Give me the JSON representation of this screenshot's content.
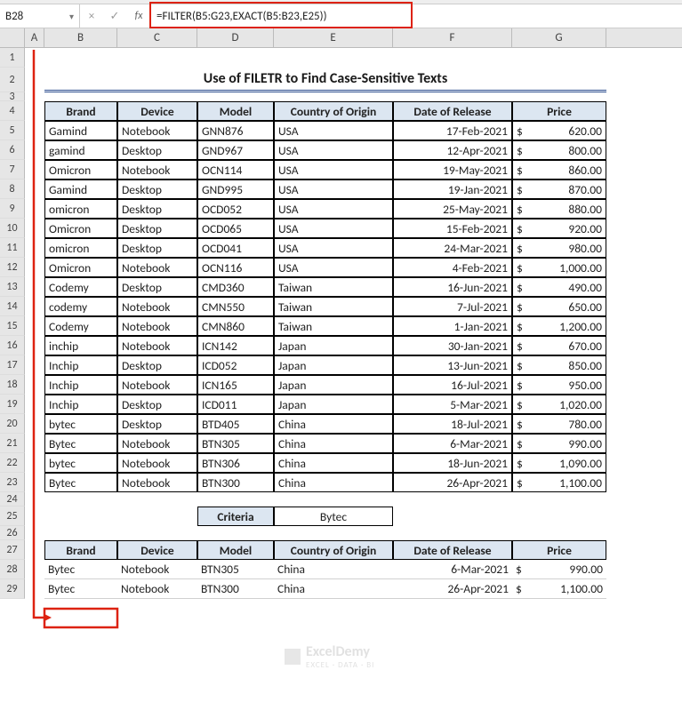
{
  "name_box": "B28",
  "fx_label": "fx",
  "formula": "=FILTER(B5:G23,EXACT(B5:B23,E25))",
  "columns": {
    "A": "A",
    "B": "B",
    "C": "C",
    "D": "D",
    "E": "E",
    "F": "F",
    "G": "G"
  },
  "title": "Use of FILETR to Find Case-Sensitive Texts",
  "headers": [
    "Brand",
    "Device",
    "Model",
    "Country of Origin",
    "Date of Release",
    "Price"
  ],
  "rows": [
    {
      "n": 5,
      "b": "Gamind",
      "c": "Notebook",
      "d": "GNN876",
      "e": "USA",
      "f": "17-Feb-2021",
      "g": "620.00"
    },
    {
      "n": 6,
      "b": "gamind",
      "c": "Desktop",
      "d": "GND967",
      "e": "USA",
      "f": "12-Apr-2021",
      "g": "800.00"
    },
    {
      "n": 7,
      "b": "Omicron",
      "c": "Notebook",
      "d": "OCN114",
      "e": "USA",
      "f": "19-May-2021",
      "g": "860.00"
    },
    {
      "n": 8,
      "b": "Gamind",
      "c": "Desktop",
      "d": "GND995",
      "e": "USA",
      "f": "19-Jan-2021",
      "g": "870.00"
    },
    {
      "n": 9,
      "b": "omicron",
      "c": "Desktop",
      "d": "OCD052",
      "e": "USA",
      "f": "25-May-2021",
      "g": "880.00"
    },
    {
      "n": 10,
      "b": "Omicron",
      "c": "Desktop",
      "d": "OCD065",
      "e": "USA",
      "f": "15-Feb-2021",
      "g": "920.00"
    },
    {
      "n": 11,
      "b": "omicron",
      "c": "Desktop",
      "d": "OCD041",
      "e": "USA",
      "f": "24-Mar-2021",
      "g": "980.00"
    },
    {
      "n": 12,
      "b": "Omicron",
      "c": "Notebook",
      "d": "OCN116",
      "e": "USA",
      "f": "4-Feb-2021",
      "g": "1,000.00"
    },
    {
      "n": 13,
      "b": "Codemy",
      "c": "Desktop",
      "d": "CMD360",
      "e": "Taiwan",
      "f": "16-Jun-2021",
      "g": "490.00"
    },
    {
      "n": 14,
      "b": "codemy",
      "c": "Notebook",
      "d": "CMN550",
      "e": "Taiwan",
      "f": "7-Jul-2021",
      "g": "650.00"
    },
    {
      "n": 15,
      "b": "Codemy",
      "c": "Notebook",
      "d": "CMN860",
      "e": "Taiwan",
      "f": "1-Jan-2021",
      "g": "1,200.00"
    },
    {
      "n": 16,
      "b": "inchip",
      "c": "Notebook",
      "d": "ICN142",
      "e": "Japan",
      "f": "30-Jan-2021",
      "g": "670.00"
    },
    {
      "n": 17,
      "b": "Inchip",
      "c": "Desktop",
      "d": "ICD052",
      "e": "Japan",
      "f": "13-Jun-2021",
      "g": "850.00"
    },
    {
      "n": 18,
      "b": "Inchip",
      "c": "Notebook",
      "d": "ICN165",
      "e": "Japan",
      "f": "16-Jul-2021",
      "g": "950.00"
    },
    {
      "n": 19,
      "b": "Inchip",
      "c": "Desktop",
      "d": "ICD011",
      "e": "Japan",
      "f": "5-Mar-2021",
      "g": "1,020.00"
    },
    {
      "n": 20,
      "b": "bytec",
      "c": "Desktop",
      "d": "BTD405",
      "e": "China",
      "f": "18-Jul-2021",
      "g": "780.00"
    },
    {
      "n": 21,
      "b": "Bytec",
      "c": "Notebook",
      "d": "BTN305",
      "e": "China",
      "f": "6-Mar-2021",
      "g": "990.00"
    },
    {
      "n": 22,
      "b": "bytec",
      "c": "Notebook",
      "d": "BTN306",
      "e": "China",
      "f": "18-Jun-2021",
      "g": "1,090.00"
    },
    {
      "n": 23,
      "b": "Bytec",
      "c": "Notebook",
      "d": "BTN300",
      "e": "China",
      "f": "26-Apr-2021",
      "g": "1,100.00"
    }
  ],
  "criteria": {
    "label": "Criteria",
    "value": "Bytec"
  },
  "result_headers": [
    "Brand",
    "Device",
    "Model",
    "Country of Origin",
    "Date of Release",
    "Price"
  ],
  "results": [
    {
      "n": 28,
      "b": "Bytec",
      "c": "Notebook",
      "d": "BTN305",
      "e": "China",
      "f": "6-Mar-2021",
      "g": "990.00"
    },
    {
      "n": 29,
      "b": "Bytec",
      "c": "Notebook",
      "d": "BTN300",
      "e": "China",
      "f": "26-Apr-2021",
      "g": "1,100.00"
    }
  ],
  "currency": "$",
  "row_labels": {
    "r1": "1",
    "r2": "2",
    "r3": "3",
    "r4": "4",
    "r24": "24",
    "r25": "25",
    "r26": "26",
    "r27": "27"
  },
  "watermark": {
    "name": "ExcelDemy",
    "sub": "EXCEL · DATA · BI"
  }
}
